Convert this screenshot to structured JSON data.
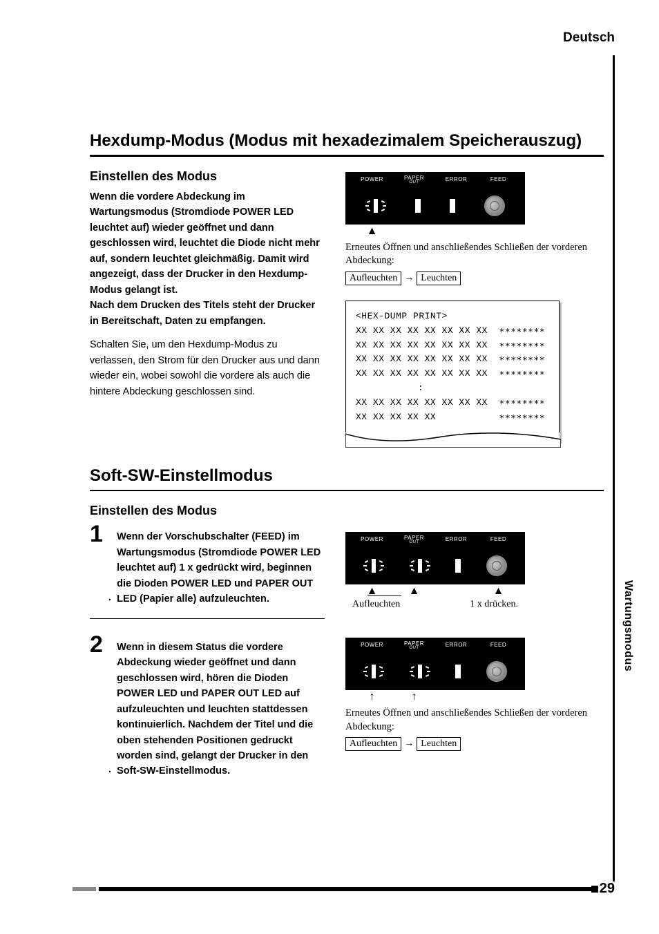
{
  "language_label": "Deutsch",
  "side_tab": "Wartungsmodus",
  "page_number": "29",
  "section1": {
    "title": "Hexdump-Modus (Modus mit hexadezimalem Speicherauszug)",
    "subhead": "Einstellen des Modus",
    "para1": "Wenn die vordere Abdeckung im Wartungsmodus (Stromdiode POWER LED leuchtet auf) wieder geöffnet und dann geschlossen wird, leuchtet die Diode nicht mehr auf, sondern  leuchtet gleichmäßig. Damit wird angezeigt, dass der Drucker in den Hexdump-Modus gelangt ist.",
    "para1b": "Nach dem Drucken des Titels steht der Drucker in Bereitschaft, Daten zu empfangen.",
    "para2": "Schalten Sie, um den Hexdump-Modus zu verlassen, den Strom für den Drucker aus und dann wieder ein, wobei sowohl die vordere als auch die hintere Abdeckung geschlossen sind."
  },
  "panel_labels": {
    "power": "POWER",
    "paper": "PAPER",
    "out": "OUT",
    "error": "ERROR",
    "feed": "FEED"
  },
  "fig1": {
    "caption": "Erneutes Öffnen und anschließendes Schließen der vorderen Abdeckung:",
    "state_from": "Aufleuchten",
    "state_to": "Leuchten"
  },
  "printout": {
    "title": "<HEX-DUMP PRINT>",
    "rows_full": "XX XX XX XX XX XX XX XX",
    "stars": "∗∗∗∗∗∗∗∗",
    "dots": ":",
    "last_hex": "XX XX XX XX XX"
  },
  "section2": {
    "title": "Soft-SW-Einstellmodus",
    "subhead": "Einstellen des Modus",
    "step1_num": "1",
    "step1_text": "Wenn der Vorschubschalter (FEED) im Wartungsmodus (Stromdiode POWER LED leuchtet auf) 1 x gedrückt wird, beginnen die Dioden POWER LED  und PAPER OUT LED (Papier alle) aufzuleuchten.",
    "step2_num": "2",
    "step2_text": "Wenn in diesem Status die vordere Abdeckung wieder geöffnet und dann geschlossen wird, hören die Dioden POWER LED und PAPER OUT LED auf aufzuleuchten und leuchten stattdessen kontinuierlich. Nachdem der Titel und die oben stehenden Positionen gedruckt worden sind, gelangt der Drucker in den Soft-SW-Einstellmodus."
  },
  "fig2": {
    "hint_left": "Aufleuchten",
    "hint_right": "1 x drücken."
  },
  "fig3": {
    "caption": "Erneutes Öffnen und anschließendes Schließen der vorderen Abdeckung:",
    "state_from": "Aufleuchten",
    "state_to": "Leuchten"
  }
}
